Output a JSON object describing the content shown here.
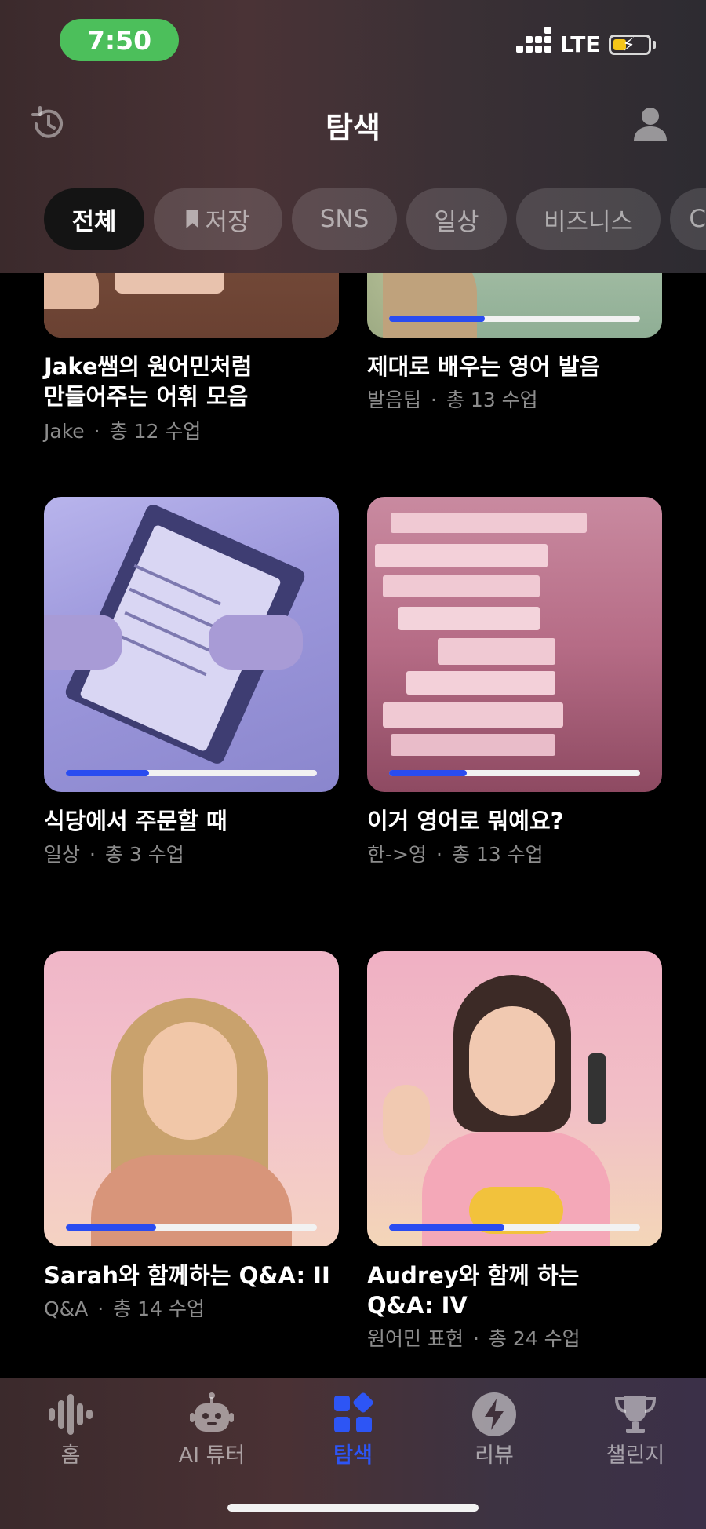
{
  "status_bar": {
    "time": "7:50",
    "network": "LTE"
  },
  "header": {
    "title": "탐색"
  },
  "filters": [
    {
      "label": "전체",
      "active": true
    },
    {
      "label": "저장",
      "active": false,
      "icon": "bookmark-icon"
    },
    {
      "label": "SNS",
      "active": false
    },
    {
      "label": "일상",
      "active": false
    },
    {
      "label": "비즈니스",
      "active": false
    },
    {
      "label": "C",
      "active": false
    }
  ],
  "courses": [
    {
      "title": "Jake쌤의 원어민처럼\n만들어주는 어휘 모음",
      "category": "Jake",
      "lessons": "총 12 수업"
    },
    {
      "title": "제대로 배우는 영어 발음",
      "category": "발음팁",
      "lessons": "총 13 수업",
      "progress": 0.38
    },
    {
      "title": "식당에서 주문할 때",
      "category": "일상",
      "lessons": "총 3 수업",
      "progress": 0.33
    },
    {
      "title": "이거 영어로 뭐예요?",
      "category": "한->영",
      "lessons": "총 13 수업",
      "progress": 0.31
    },
    {
      "title": "Sarah와 함께하는 Q&A: II",
      "category": "Q&A",
      "lessons": "총 14 수업",
      "progress": 0.36
    },
    {
      "title": "Audrey와 함께 하는\nQ&A: IV",
      "category": "원어민 표현",
      "lessons": "총 24 수업",
      "progress": 0.46
    }
  ],
  "tabs": [
    {
      "label": "홈",
      "icon": "waveform-icon",
      "active": false
    },
    {
      "label": "AI 튜터",
      "icon": "robot-icon",
      "active": false
    },
    {
      "label": "탐색",
      "icon": "explore-grid-icon",
      "active": true
    },
    {
      "label": "리뷰",
      "icon": "lightning-icon",
      "active": false
    },
    {
      "label": "챌린지",
      "icon": "trophy-icon",
      "active": false
    }
  ],
  "colors": {
    "accent": "#2d55f5",
    "progress": "#2a4cf0",
    "status_green": "#4cbf5b"
  }
}
